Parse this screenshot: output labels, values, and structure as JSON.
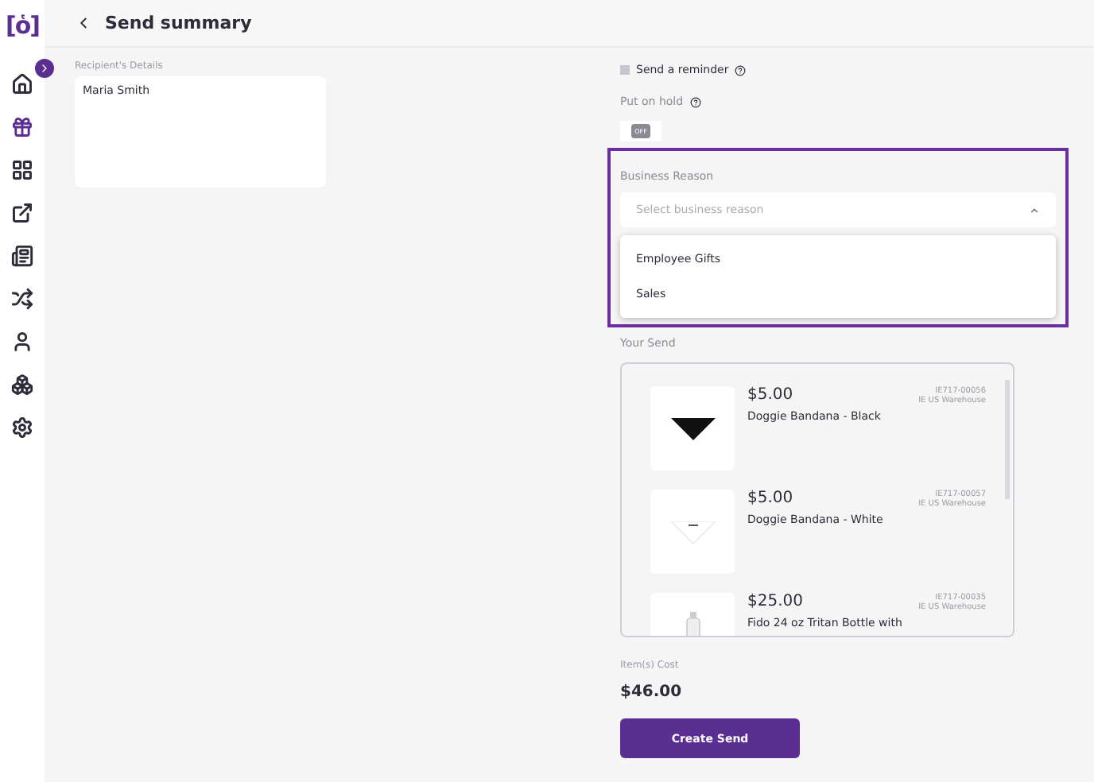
{
  "logo": {
    "text": "[ὁ]"
  },
  "sidebar": {
    "items": [
      {
        "selected": false
      },
      {
        "selected": true
      },
      {
        "selected": false
      },
      {
        "selected": false
      },
      {
        "selected": false
      },
      {
        "selected": false
      },
      {
        "selected": false
      },
      {
        "selected": false
      },
      {
        "selected": false
      }
    ]
  },
  "header": {
    "title": "Send summary"
  },
  "recipient": {
    "label": "Recipient's Details",
    "name": "Maria Smith"
  },
  "reminder": {
    "label": "Send a reminder",
    "checked": false
  },
  "hold": {
    "label": "Put on hold",
    "on": false,
    "toggle_text": "OFF"
  },
  "business_reason": {
    "label": "Business Reason",
    "placeholder": "Select business reason",
    "expanded": true,
    "options": [
      "Employee Gifts",
      "Sales"
    ]
  },
  "your_send": {
    "label": "Your Send",
    "items": [
      {
        "price": "$5.00",
        "name": "Doggie Bandana - Black",
        "sku": "IE717-00056",
        "warehouse": "IE US Warehouse",
        "kind": "black"
      },
      {
        "price": "$5.00",
        "name": "Doggie Bandana - White",
        "sku": "IE717-00057",
        "warehouse": "IE US Warehouse",
        "kind": "white"
      },
      {
        "price": "$25.00",
        "name": "Fido 24 oz Tritan Bottle with",
        "sku": "IE717-00035",
        "warehouse": "IE US Warehouse",
        "kind": "bottle"
      }
    ]
  },
  "cost": {
    "label": "Item(s) Cost",
    "value": "$46.00"
  },
  "button": {
    "label": "Create Send"
  }
}
